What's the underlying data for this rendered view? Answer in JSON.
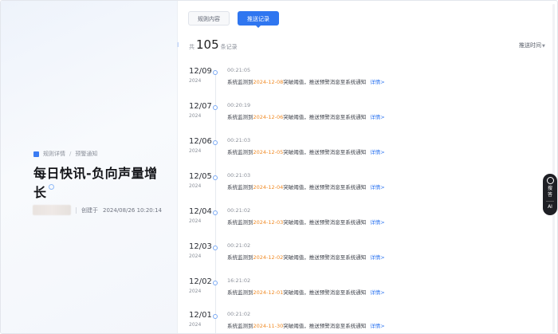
{
  "breadcrumb": {
    "root": "规则详情",
    "current": "预警通知"
  },
  "rule": {
    "title": "每日快讯-负向声量增长",
    "created_label": "创建于",
    "created_time": "2024/08/26 10:20:14"
  },
  "tabs": [
    {
      "label": "规则内容",
      "active": false
    },
    {
      "label": "推送记录",
      "active": true
    }
  ],
  "summary": {
    "prefix": "共",
    "count": "105",
    "suffix": "条记录"
  },
  "sort": {
    "label": "推送时间",
    "arrow": "▼"
  },
  "records": [
    {
      "date": "12/09",
      "year": "2024",
      "time": "00:21:05",
      "msg_prefix": "系统监测到",
      "msg_date": "2024-12-08",
      "msg_suffix": "突破阈值，推送预警消息至系统通知",
      "link": "详情>"
    },
    {
      "date": "12/07",
      "year": "2024",
      "time": "00:20:19",
      "msg_prefix": "系统监测到",
      "msg_date": "2024-12-06",
      "msg_suffix": "突破阈值，推送预警消息至系统通知",
      "link": "详情>"
    },
    {
      "date": "12/06",
      "year": "2024",
      "time": "00:21:03",
      "msg_prefix": "系统监测到",
      "msg_date": "2024-12-05",
      "msg_suffix": "突破阈值，推送预警消息至系统通知",
      "link": "详情>"
    },
    {
      "date": "12/05",
      "year": "2024",
      "time": "00:21:03",
      "msg_prefix": "系统监测到",
      "msg_date": "2024-12-04",
      "msg_suffix": "突破阈值，推送预警消息至系统通知",
      "link": "详情>"
    },
    {
      "date": "12/04",
      "year": "2024",
      "time": "00:21:02",
      "msg_prefix": "系统监测到",
      "msg_date": "2024-12-03",
      "msg_suffix": "突破阈值，推送预警消息至系统通知",
      "link": "详情>"
    },
    {
      "date": "12/03",
      "year": "2024",
      "time": "00:21:02",
      "msg_prefix": "系统监测到",
      "msg_date": "2024-12-02",
      "msg_suffix": "突破阈值，推送预警消息至系统通知",
      "link": "详情>"
    },
    {
      "date": "12/02",
      "year": "2024",
      "time": "16:21:02",
      "msg_prefix": "系统监测到",
      "msg_date": "2024-12-01",
      "msg_suffix": "突破阈值，推送预警消息至系统通知",
      "link": "详情>"
    },
    {
      "date": "12/01",
      "year": "2024",
      "time": "00:21:02",
      "msg_prefix": "系统监测到",
      "msg_date": "2024-11-30",
      "msg_suffix": "突破阈值，推送预警消息至系统通知",
      "link": "详情>"
    }
  ],
  "ai_widget": {
    "label_top": "搜",
    "label_mid": "答",
    "label_bottom": "AI"
  },
  "colors": {
    "accent": "#2f76f0",
    "highlight": "#f08a24"
  }
}
